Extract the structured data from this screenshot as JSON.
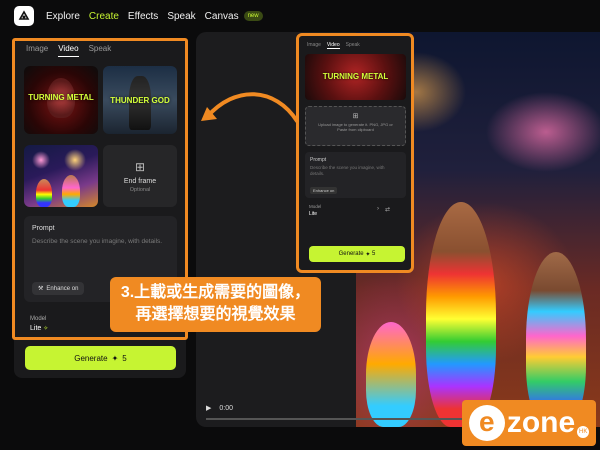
{
  "nav": {
    "items": [
      "Explore",
      "Create",
      "Effects",
      "Speak",
      "Canvas"
    ],
    "active": "Create",
    "new_badge": "new"
  },
  "panel": {
    "tabs": [
      "Image",
      "Video",
      "Speak"
    ],
    "active_tab": "Video",
    "thumbs": {
      "first_title": "TURNING METAL",
      "second_title": "THUNDER GOD",
      "end_frame_label": "End frame",
      "end_frame_sub": "Optional"
    },
    "prompt": {
      "title": "Prompt",
      "placeholder": "Describe the scene you imagine, with details.",
      "enhance_label": "Enhance on"
    },
    "model": {
      "label": "Model",
      "value": "Lite"
    },
    "generate_label": "Generate",
    "generate_cost": "5"
  },
  "video": {
    "time": "0:00"
  },
  "popup": {
    "tabs": [
      "Image",
      "Video",
      "Speak"
    ],
    "active_tab": "Video",
    "thumb_title": "TURNING METAL",
    "upload_text": "Upload image to generate it. PNG, JPG or Paste from clipboard",
    "prompt_title": "Prompt",
    "prompt_placeholder": "Describe the scene you imagine, with details.",
    "enhance_label": "Enhance on",
    "model_label": "Model",
    "model_value": "Lite",
    "generate_label": "Generate",
    "generate_cost": "5"
  },
  "callout": {
    "line1": "3.上載或生成需要的圖像，",
    "line2": "再選擇想要的視覺效果"
  },
  "watermark": {
    "text": "zone",
    "suffix": "HK"
  },
  "colors": {
    "accent": "#c6f432",
    "annotation": "#f08a22"
  }
}
